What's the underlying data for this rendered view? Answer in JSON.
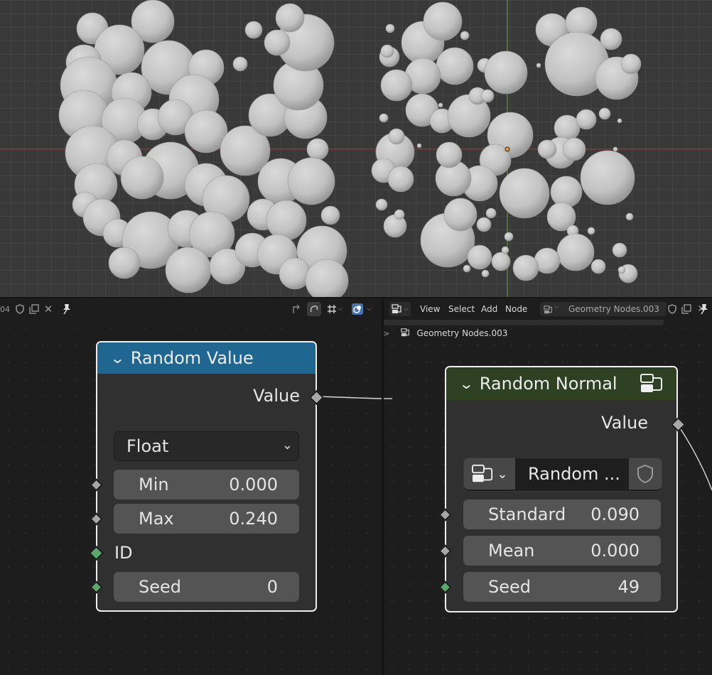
{
  "left_header": {
    "datablock_suffix": "04"
  },
  "right_header": {
    "menu": [
      "View",
      "Select",
      "Add",
      "Node"
    ],
    "datablock": "Geometry Nodes.003",
    "breadcrumb": "Geometry Nodes.003"
  },
  "node_random_value": {
    "title": "Random Value",
    "output_label": "Value",
    "data_type": "Float",
    "inputs": [
      {
        "label": "Min",
        "value": "0.000"
      },
      {
        "label": "Max",
        "value": "0.240"
      },
      {
        "label": "ID"
      },
      {
        "label": "Seed",
        "value": "0"
      }
    ],
    "header_color": "#1f6691"
  },
  "node_random_normal": {
    "title": "Random Normal",
    "output_label": "Value",
    "group_name": "Random ...",
    "inputs": [
      {
        "label": "Standard",
        "value": "0.090"
      },
      {
        "label": "Mean",
        "value": "0.000"
      },
      {
        "label": "Seed",
        "value": "49"
      }
    ],
    "header_color": "#2e4122"
  },
  "colors": {
    "socket_float": "#a8a8a8",
    "socket_int": "#5aa86c",
    "node_outline": "#efefef"
  }
}
